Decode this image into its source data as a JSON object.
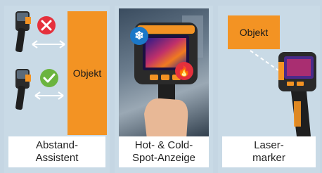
{
  "panels": [
    {
      "id": "abstand",
      "caption": "Abstand-\nAssistent",
      "object_label": "Objekt"
    },
    {
      "id": "hotcold",
      "caption": "Hot- & Cold-\nSpot-Anzeige"
    },
    {
      "id": "laser",
      "caption": "Laser-\nmarker",
      "object_label": "Objekt"
    }
  ],
  "icons": {
    "wrong": "x-icon",
    "right": "check-icon",
    "cold": "snowflake-icon",
    "hot": "flame-icon"
  },
  "colors": {
    "accent_orange": "#f39323",
    "panel_blue": "#c9dae6",
    "red": "#e5303c",
    "green": "#6bb43f",
    "cold_blue": "#1b78c8"
  }
}
